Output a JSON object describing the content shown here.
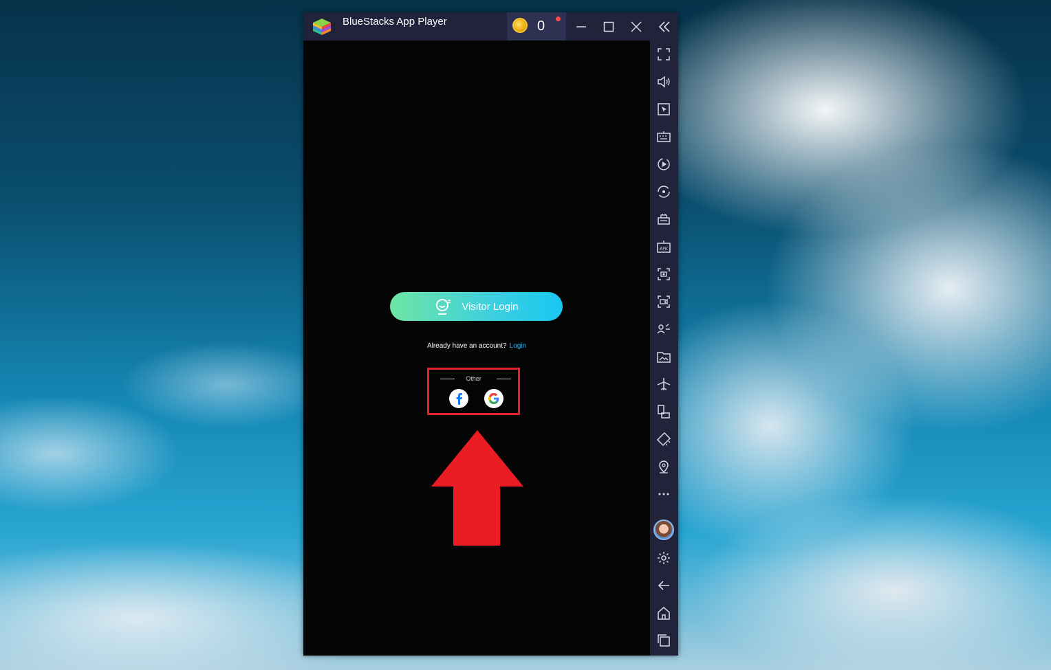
{
  "window": {
    "title": "BlueStacks App Player",
    "coin_count": "0"
  },
  "login": {
    "visitor_button": "Visitor Login",
    "account_prompt": "Already have an account?",
    "login_link": "Login",
    "other_label": "Other"
  },
  "sidebar_icons": [
    "fullscreen-icon",
    "volume-icon",
    "pointer-icon",
    "keyboard-icon",
    "macro-play-icon",
    "rotate-sync-icon",
    "multi-instance-icon",
    "apk-install-icon",
    "screenshot-icon",
    "record-video-icon",
    "game-controls-icon",
    "media-folder-icon",
    "airplane-mode-icon",
    "resize-icon",
    "eco-mode-icon",
    "location-icon",
    "more-icon",
    "avatar",
    "settings-icon",
    "back-icon",
    "home-icon",
    "recent-apps-icon"
  ],
  "colors": {
    "titlebar": "#21233a",
    "annotation": "#e3232b",
    "link": "#2fb2ee",
    "button_gradient_start": "#6ee6a4",
    "button_gradient_end": "#19c6f1"
  }
}
